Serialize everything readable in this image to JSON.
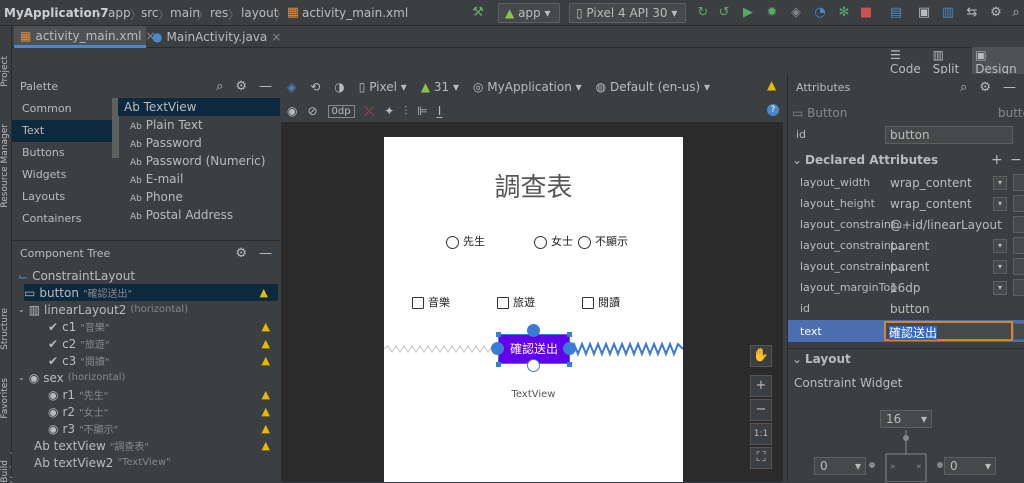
{
  "titlebar": {
    "breadcrumbs": [
      "MyApplication7",
      "app",
      "src",
      "main",
      "res",
      "layout",
      "activity_main.xml"
    ],
    "run_config": "app",
    "device": "Pixel 4 API 30"
  },
  "tabs": [
    {
      "label": "activity_main.xml"
    },
    {
      "label": "MainActivity.java"
    }
  ],
  "view_modes": {
    "code": "Code",
    "split": "Split",
    "design": "Design"
  },
  "left_tool_windows": [
    "Project",
    "Resource Manager",
    "Structure",
    "Favorites",
    "Build Variants"
  ],
  "palette": {
    "title": "Palette",
    "categories": [
      "Common",
      "Text",
      "Buttons",
      "Widgets",
      "Layouts",
      "Containers"
    ],
    "selected_category": "Text",
    "items": [
      "Ab TextView",
      "Plain Text",
      "Password",
      "Password (Numeric)",
      "E-mail",
      "Phone",
      "Postal Address"
    ]
  },
  "design_toolbar": {
    "device": "Pixel",
    "api": "31",
    "theme": "MyApplication",
    "locale": "Default (en-us)",
    "margin": "0dp"
  },
  "component_tree": {
    "title": "Component Tree",
    "nodes": [
      {
        "name": "ConstraintLayout",
        "sub": ""
      },
      {
        "name": "button",
        "sub": "\"確認送出\""
      },
      {
        "name": "linearLayout2",
        "sub": "(horizontal)"
      },
      {
        "name": "c1",
        "sub": "\"音樂\""
      },
      {
        "name": "c2",
        "sub": "\"旅遊\""
      },
      {
        "name": "c3",
        "sub": "\"閱讀\""
      },
      {
        "name": "sex",
        "sub": "(horizontal)"
      },
      {
        "name": "r1",
        "sub": "\"先生\""
      },
      {
        "name": "r2",
        "sub": "\"女士\""
      },
      {
        "name": "r3",
        "sub": "\"不顯示\""
      },
      {
        "name": "Ab textView",
        "sub": "\"調查表\""
      },
      {
        "name": "Ab textView2",
        "sub": "\"TextView\""
      }
    ]
  },
  "phone": {
    "title": "調查表",
    "radios": [
      "先生",
      "女士",
      "不顯示"
    ],
    "checkboxes": [
      "音樂",
      "旅遊",
      "閱讀"
    ],
    "button": "確認送出",
    "textview2": "TextView"
  },
  "attributes": {
    "title": "Attributes",
    "widget": "Button",
    "widget_id": "butto",
    "id_label": "id",
    "id_value": "button",
    "declared_title": "Declared Attributes",
    "rows": [
      {
        "name": "layout_width",
        "value": "wrap_content"
      },
      {
        "name": "layout_height",
        "value": "wrap_content"
      },
      {
        "name": "layout_constraint...",
        "value": "@+id/linearLayout"
      },
      {
        "name": "layout_constraint...",
        "value": "parent"
      },
      {
        "name": "layout_constraint...",
        "value": "parent"
      },
      {
        "name": "layout_marginTop",
        "value": "16dp"
      },
      {
        "name": "id",
        "value": "button"
      },
      {
        "name": "text",
        "value": "確認送出"
      }
    ],
    "layout_title": "Layout",
    "constraint_widget": "Constraint Widget",
    "margin_top": "16",
    "margin_left": "0",
    "margin_right": "0"
  }
}
